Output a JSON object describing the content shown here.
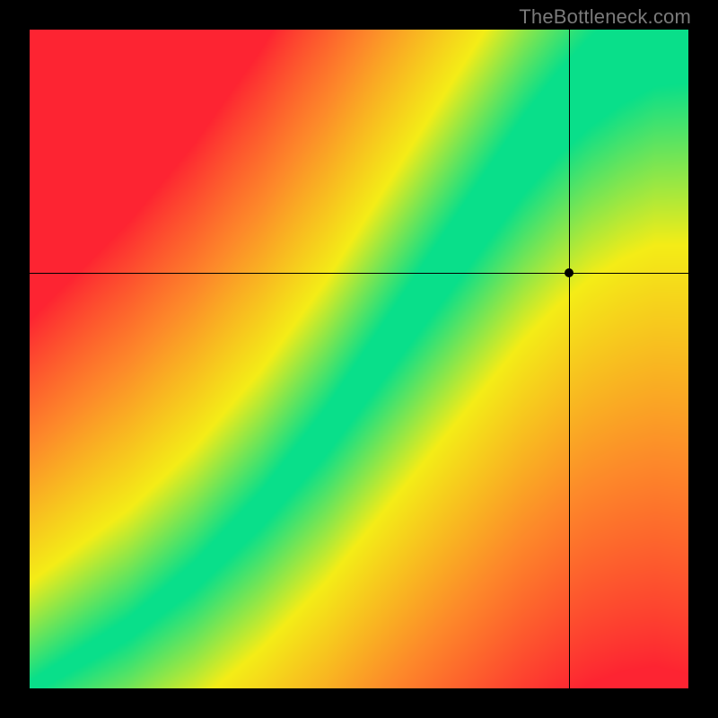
{
  "watermark": "TheBottleneck.com",
  "chart_data": {
    "type": "heatmap",
    "title": "",
    "xlabel": "",
    "ylabel": "",
    "xlim": [
      0,
      1
    ],
    "ylim": [
      0,
      1
    ],
    "grid": false,
    "legend": false,
    "crosshair": {
      "x": 0.82,
      "y": 0.63
    },
    "marker": {
      "x": 0.82,
      "y": 0.63
    },
    "ridge": {
      "description": "green optimal band where GPU and CPU scores match",
      "x": [
        0.0,
        0.05,
        0.1,
        0.15,
        0.2,
        0.25,
        0.3,
        0.35,
        0.4,
        0.45,
        0.5,
        0.55,
        0.6,
        0.65,
        0.7,
        0.75,
        0.8,
        0.85,
        0.9,
        0.95,
        1.0
      ],
      "y": [
        0.0,
        0.03,
        0.06,
        0.09,
        0.13,
        0.17,
        0.22,
        0.27,
        0.33,
        0.39,
        0.46,
        0.53,
        0.6,
        0.67,
        0.74,
        0.81,
        0.87,
        0.92,
        0.96,
        0.99,
        1.0
      ],
      "half_width": [
        0.01,
        0.012,
        0.014,
        0.016,
        0.018,
        0.021,
        0.024,
        0.027,
        0.031,
        0.035,
        0.039,
        0.043,
        0.047,
        0.051,
        0.055,
        0.059,
        0.063,
        0.067,
        0.071,
        0.075,
        0.08
      ]
    },
    "color_stops": {
      "red": "#fd2432",
      "orange": "#fd8b2a",
      "yellow": "#f4ed17",
      "green": "#09df8a"
    }
  }
}
